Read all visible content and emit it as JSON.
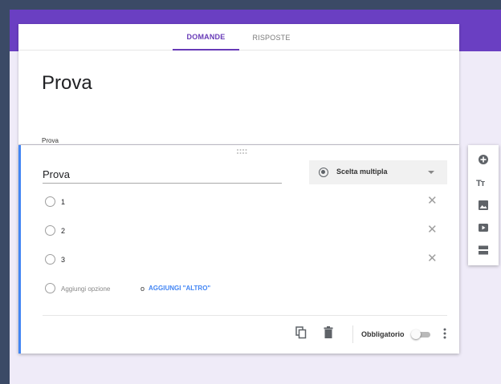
{
  "tabs": [
    {
      "label": "DOMANDE",
      "active": true
    },
    {
      "label": "RISPOSTE",
      "active": false
    }
  ],
  "form": {
    "title": "Prova",
    "description": "Prova"
  },
  "question": {
    "title": "Prova",
    "type_label": "Scelta multipla",
    "options": [
      "1",
      "2",
      "3"
    ],
    "add_option_label": "Aggiungi opzione",
    "or_word": "o",
    "add_other_label": "AGGIUNGI \"ALTRO\""
  },
  "footer": {
    "required_label": "Obbligatorio",
    "required_on": false,
    "icons": [
      "copy-icon",
      "delete-icon",
      "more-vert-icon"
    ]
  },
  "side_toolbar": {
    "icons": [
      "add-circle-icon",
      "text-format-icon",
      "image-icon",
      "video-icon",
      "section-icon"
    ],
    "text_icon_glyph": "Tт"
  },
  "colors": {
    "accent": "#673ab7",
    "header_band": "#6a3fc2",
    "page_bg": "#efebf8",
    "link": "#4285f4",
    "outer_bg": "#3b4a66"
  }
}
